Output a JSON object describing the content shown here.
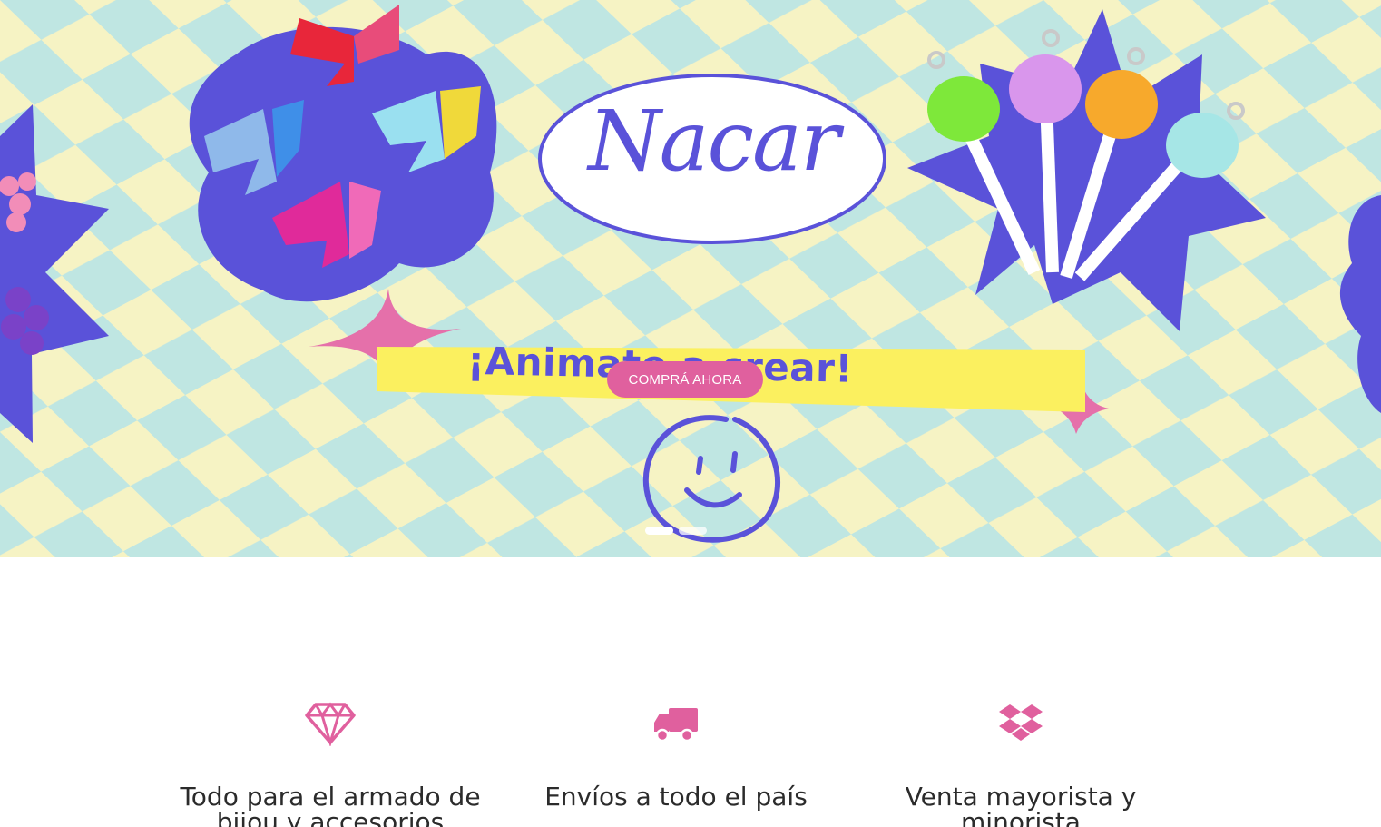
{
  "hero": {
    "logo": "Nacar",
    "tagline": "¡Animate a crear!",
    "cta_label": "COMPRÁ AHORA",
    "slides_count": 2,
    "active_slide": 1
  },
  "features": [
    {
      "icon": "diamond-icon",
      "label": "Todo para el armado de bijou y accesorios"
    },
    {
      "icon": "truck-icon",
      "label": "Envíos a todo el país"
    },
    {
      "icon": "boxes-icon",
      "label": "Venta mayorista y minorista"
    }
  ],
  "colors": {
    "accent_pink": "#e0609e",
    "brand_purple": "#5a52d9",
    "checker_yellow": "#f6f3c4",
    "checker_mint": "#bfe6e2",
    "banner_yellow": "#fbf05f"
  }
}
